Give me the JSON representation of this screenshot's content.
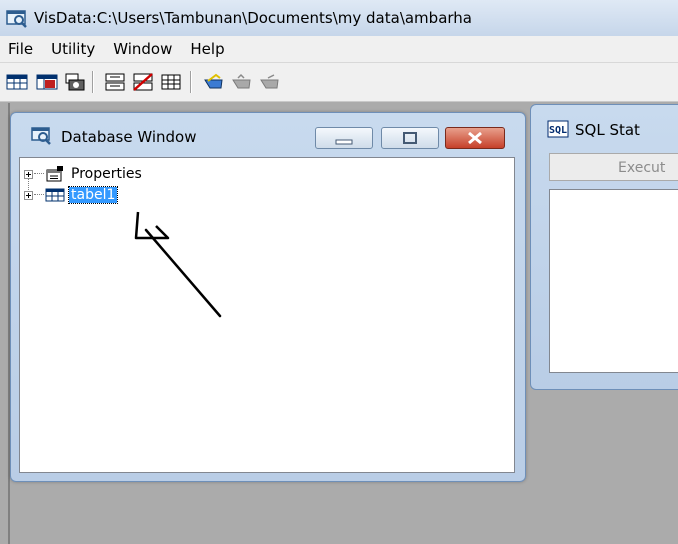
{
  "window": {
    "title": "VisData:C:\\Users\\Tambunan\\Documents\\my data\\ambarha",
    "icon": "database-window-icon"
  },
  "menu": {
    "items": [
      "File",
      "Utility",
      "Window",
      "Help"
    ]
  },
  "toolbar": {
    "buttons": [
      "table-type-icon",
      "dynaset-type-icon",
      "snapshot-type-icon",
      "data-control-icon",
      "no-data-control-icon",
      "grid-control-icon",
      "begin-transaction-icon",
      "commit-icon",
      "rollback-icon"
    ]
  },
  "database_window": {
    "title": "Database Window",
    "tree": [
      {
        "label": "Properties",
        "icon": "properties-icon",
        "selected": false
      },
      {
        "label": "tabel1",
        "icon": "table-icon",
        "selected": true
      }
    ]
  },
  "sql_window": {
    "title": "SQL Stat",
    "execute_label": "Execut",
    "icon": "sql-icon"
  },
  "colors": {
    "selection": "#3399ff",
    "caption": "#c8daee",
    "mdi_background": "#ababab"
  }
}
